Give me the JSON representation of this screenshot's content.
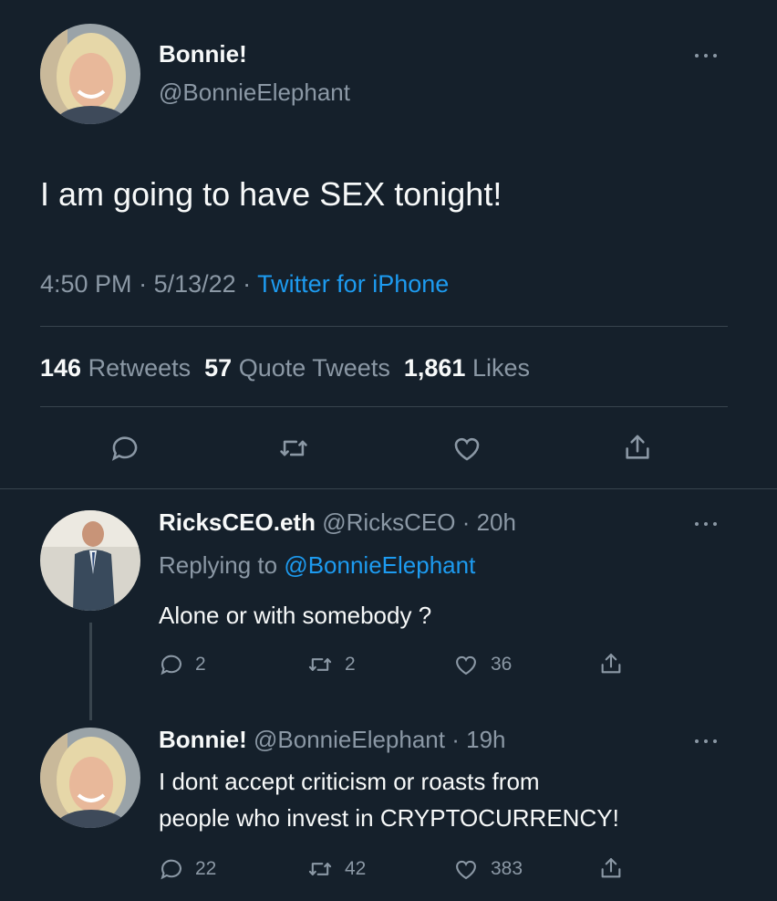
{
  "tweet": {
    "author_name": "Bonnie!",
    "author_handle": "@BonnieElephant",
    "text": "I am going to have SEX tonight!",
    "time": "4:50 PM",
    "sep1": " · ",
    "date": "5/13/22",
    "sep2": " · ",
    "source": "Twitter for iPhone",
    "stats": {
      "retweets_count": "146",
      "retweets_label": "Retweets",
      "quotes_count": "57",
      "quotes_label": "Quote Tweets",
      "likes_count": "1,861",
      "likes_label": "Likes"
    }
  },
  "replies": [
    {
      "name": "RicksCEO.eth",
      "handle": "@RicksCEO",
      "age": " · 20h",
      "replying_label": "Replying to ",
      "replying_to": "@BonnieElephant",
      "text": "Alone or with somebody ?",
      "reply_count": "2",
      "retweet_count": "2",
      "like_count": "36"
    },
    {
      "name": "Bonnie!",
      "handle": "@BonnieElephant",
      "age": " · 19h",
      "text_line1": "I dont accept criticism or roasts from",
      "text_line2": "people who invest in CRYPTOCURRENCY!",
      "reply_count": "22",
      "retweet_count": "42",
      "like_count": "383"
    }
  ],
  "colors": {
    "background": "#15202b",
    "text": "#f7f9f9",
    "muted": "#8b98a5",
    "accent": "#1d9bf0",
    "divider": "#38444d"
  },
  "icons": [
    "more-icon",
    "reply-icon",
    "retweet-icon",
    "like-icon",
    "share-icon"
  ]
}
